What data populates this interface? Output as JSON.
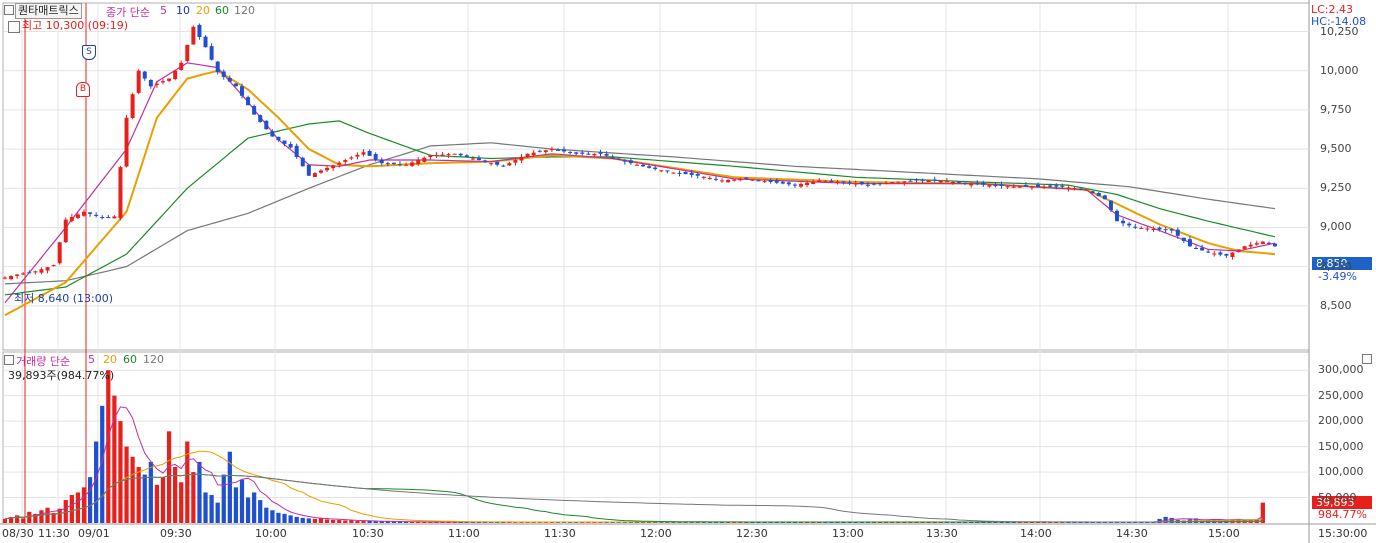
{
  "header": {
    "stock_name": "퀀타매트릭스",
    "price_indicator": "종가 단순",
    "ma_periods": [
      "5",
      "10",
      "20",
      "60",
      "120"
    ],
    "high_annotation": "최고 10,300 (09:19)",
    "low_annotation": "최저 8,640 (13:00)",
    "lc_label": "LC:2.43",
    "hc_label": "HC:-14.08",
    "current_price_label": "8,850",
    "current_change_label": "-3.49%"
  },
  "volume_header": {
    "title": "거래량 단순",
    "ma_periods": [
      "5",
      "20",
      "60",
      "120"
    ],
    "current_volume": "39,893주(984.77%)",
    "current_badge": "39,893",
    "current_pct": "984.77%"
  },
  "markers": {
    "sell": "S",
    "buy": "B"
  },
  "colors": {
    "up": "#e8201c",
    "down": "#1e50d0",
    "ma5": "#c030a0",
    "ma10": "#2030b0",
    "ma20": "#e8a000",
    "ma60": "#1a8a2a",
    "ma120": "#777777",
    "current_badge_bg": "#1e62c8",
    "volume_badge_bg": "#e8201c"
  },
  "icons": {
    "window_icon": "square-icon",
    "settings_icon": "grid-icon",
    "zoom_icon": "square-icon"
  },
  "chart_data": [
    {
      "type": "line",
      "title": "퀀타매트릭스",
      "ylim": [
        8250,
        10400
      ],
      "y_ticks": [
        "10,250",
        "10,000",
        "9,750",
        "9,500",
        "9,250",
        "9,000",
        "8,750",
        "8,500"
      ],
      "x_ticks": [
        "08/30",
        "11:30",
        "09/01",
        "09:30",
        "10:00",
        "10:30",
        "11:00",
        "11:30",
        "12:00",
        "12:30",
        "13:00",
        "13:30",
        "14:00",
        "14:30",
        "15:00",
        "15:30:00"
      ],
      "price_path": [
        [
          0,
          8680
        ],
        [
          2,
          8700
        ],
        [
          5,
          8720
        ],
        [
          8,
          8760
        ],
        [
          10,
          9050
        ],
        [
          13,
          9100
        ],
        [
          16,
          9060
        ],
        [
          18,
          9070
        ],
        [
          20,
          9700
        ],
        [
          22,
          10000
        ],
        [
          24,
          9900
        ],
        [
          27,
          9950
        ],
        [
          29,
          10050
        ],
        [
          31,
          10280
        ],
        [
          33,
          10150
        ],
        [
          35,
          9990
        ],
        [
          38,
          9900
        ],
        [
          41,
          9720
        ],
        [
          44,
          9580
        ],
        [
          47,
          9510
        ],
        [
          50,
          9330
        ],
        [
          53,
          9380
        ],
        [
          56,
          9430
        ],
        [
          59,
          9480
        ],
        [
          62,
          9410
        ],
        [
          66,
          9400
        ],
        [
          70,
          9460
        ],
        [
          74,
          9470
        ],
        [
          78,
          9430
        ],
        [
          82,
          9390
        ],
        [
          86,
          9470
        ],
        [
          90,
          9500
        ],
        [
          94,
          9470
        ],
        [
          98,
          9470
        ],
        [
          102,
          9420
        ],
        [
          106,
          9380
        ],
        [
          110,
          9350
        ],
        [
          114,
          9330
        ],
        [
          118,
          9300
        ],
        [
          122,
          9310
        ],
        [
          126,
          9290
        ],
        [
          130,
          9270
        ],
        [
          134,
          9300
        ],
        [
          138,
          9290
        ],
        [
          142,
          9270
        ],
        [
          146,
          9290
        ],
        [
          150,
          9300
        ],
        [
          154,
          9300
        ],
        [
          158,
          9280
        ],
        [
          162,
          9270
        ],
        [
          166,
          9260
        ],
        [
          170,
          9260
        ],
        [
          174,
          9260
        ],
        [
          178,
          9240
        ],
        [
          181,
          9180
        ],
        [
          183,
          9040
        ],
        [
          186,
          9000
        ],
        [
          189,
          8990
        ],
        [
          192,
          8980
        ],
        [
          195,
          8880
        ],
        [
          198,
          8840
        ],
        [
          201,
          8820
        ],
        [
          204,
          8880
        ],
        [
          207,
          8910
        ],
        [
          209,
          8880
        ]
      ],
      "ma5": [
        [
          0,
          8520
        ],
        [
          10,
          9000
        ],
        [
          20,
          9500
        ],
        [
          25,
          9930
        ],
        [
          30,
          10050
        ],
        [
          35,
          10020
        ],
        [
          40,
          9800
        ],
        [
          45,
          9560
        ],
        [
          50,
          9400
        ],
        [
          55,
          9390
        ],
        [
          60,
          9430
        ],
        [
          70,
          9430
        ],
        [
          80,
          9420
        ],
        [
          90,
          9470
        ],
        [
          100,
          9440
        ],
        [
          120,
          9310
        ],
        [
          140,
          9280
        ],
        [
          160,
          9280
        ],
        [
          178,
          9240
        ],
        [
          183,
          9080
        ],
        [
          190,
          8980
        ],
        [
          198,
          8860
        ],
        [
          203,
          8850
        ],
        [
          209,
          8900
        ]
      ],
      "ma20": [
        [
          0,
          8440
        ],
        [
          10,
          8650
        ],
        [
          20,
          9100
        ],
        [
          25,
          9700
        ],
        [
          30,
          9950
        ],
        [
          35,
          10000
        ],
        [
          40,
          9880
        ],
        [
          45,
          9700
        ],
        [
          50,
          9500
        ],
        [
          55,
          9400
        ],
        [
          60,
          9390
        ],
        [
          70,
          9410
        ],
        [
          80,
          9420
        ],
        [
          90,
          9460
        ],
        [
          100,
          9440
        ],
        [
          120,
          9320
        ],
        [
          140,
          9290
        ],
        [
          160,
          9280
        ],
        [
          178,
          9240
        ],
        [
          183,
          9150
        ],
        [
          190,
          9020
        ],
        [
          198,
          8900
        ],
        [
          203,
          8850
        ],
        [
          209,
          8830
        ]
      ],
      "ma60": [
        [
          0,
          8570
        ],
        [
          10,
          8620
        ],
        [
          20,
          8830
        ],
        [
          30,
          9250
        ],
        [
          40,
          9570
        ],
        [
          50,
          9660
        ],
        [
          55,
          9680
        ],
        [
          60,
          9600
        ],
        [
          70,
          9460
        ],
        [
          80,
          9440
        ],
        [
          90,
          9450
        ],
        [
          100,
          9450
        ],
        [
          120,
          9390
        ],
        [
          140,
          9320
        ],
        [
          160,
          9290
        ],
        [
          175,
          9270
        ],
        [
          183,
          9210
        ],
        [
          190,
          9120
        ],
        [
          198,
          9040
        ],
        [
          209,
          8940
        ]
      ],
      "ma120": [
        [
          0,
          8640
        ],
        [
          10,
          8660
        ],
        [
          20,
          8750
        ],
        [
          30,
          8980
        ],
        [
          40,
          9090
        ],
        [
          50,
          9250
        ],
        [
          60,
          9400
        ],
        [
          70,
          9520
        ],
        [
          80,
          9540
        ],
        [
          90,
          9500
        ],
        [
          110,
          9450
        ],
        [
          130,
          9390
        ],
        [
          150,
          9350
        ],
        [
          170,
          9310
        ],
        [
          185,
          9260
        ],
        [
          198,
          9180
        ],
        [
          209,
          9120
        ]
      ]
    },
    {
      "type": "bar",
      "title": "거래량",
      "ylim": [
        0,
        320000
      ],
      "y_ticks": [
        "300,000",
        "250,000",
        "200,000",
        "150,000",
        "100,000",
        "50,000"
      ],
      "volumes": [
        8000,
        12000,
        15000,
        9000,
        22000,
        18000,
        25000,
        30000,
        20000,
        28000,
        45000,
        55000,
        60000,
        70000,
        90000,
        160000,
        230000,
        300000,
        250000,
        200000,
        150000,
        130000,
        110000,
        95000,
        120000,
        75000,
        90000,
        180000,
        110000,
        80000,
        160000,
        100000,
        120000,
        60000,
        55000,
        40000,
        95000,
        140000,
        70000,
        85000,
        50000,
        60000,
        45000,
        30000,
        25000,
        20000,
        18000,
        15000,
        12000,
        10000,
        9000,
        8000,
        9000,
        7000,
        6000,
        6000,
        5000,
        5000,
        4000,
        4000,
        4000,
        3000,
        3000,
        3000,
        3000,
        3000,
        2000,
        2000,
        2000,
        2000,
        2000,
        2000,
        2000,
        2000,
        2000,
        2000,
        2000,
        2000,
        2000,
        2000,
        2000,
        2000,
        2000,
        2000,
        2000,
        2000,
        2000,
        2000,
        2000,
        2000,
        2000,
        2000,
        2000,
        2000,
        2000,
        2000,
        2000,
        2000,
        2000,
        2000,
        2000,
        2000,
        2000,
        2000,
        2000,
        2000,
        2000,
        2000,
        2000,
        2000,
        2000,
        2000,
        2000,
        2000,
        2000,
        2000,
        2000,
        2000,
        2000,
        2000,
        2000,
        2000,
        2000,
        2000,
        2000,
        2000,
        2000,
        2000,
        2000,
        2000,
        2000,
        2000,
        2000,
        2000,
        2000,
        2000,
        2000,
        2000,
        2000,
        2000,
        2000,
        2000,
        2000,
        2000,
        2000,
        2000,
        2000,
        2000,
        2000,
        2000,
        2000,
        2000,
        2000,
        2000,
        2000,
        2000,
        2000,
        2000,
        2000,
        2000,
        2000,
        2000,
        2000,
        2000,
        2000,
        2000,
        2000,
        2000,
        2000,
        2000,
        2000,
        2000,
        2000,
        2000,
        2000,
        2000,
        2000,
        2000,
        2000,
        2000,
        2000,
        2000,
        2000,
        2000,
        2000,
        2000,
        2000,
        2000,
        2000,
        2000,
        8000,
        12000,
        10000,
        6000,
        5000,
        7000,
        9000,
        5000,
        6000,
        8000,
        6000,
        5000,
        7000,
        8000,
        6000,
        5000,
        6000,
        40000
      ]
    }
  ]
}
